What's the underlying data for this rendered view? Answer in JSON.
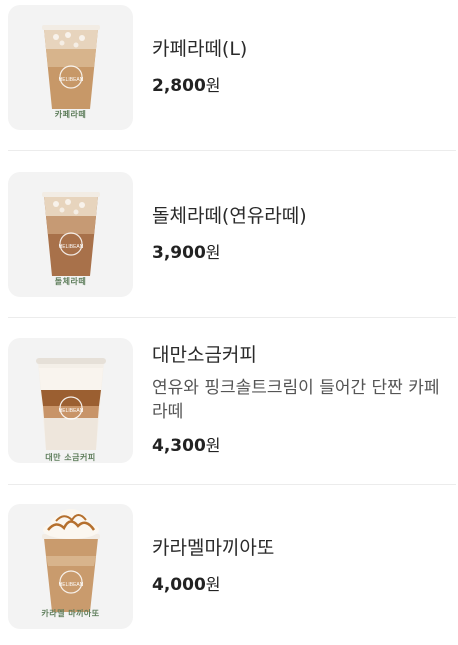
{
  "menu": {
    "items": [
      {
        "name": "카페라떼(L)",
        "price": "2,800",
        "currency": "원",
        "cup_label": "카페라떼",
        "cup_brand": "HELIBEAN",
        "image_icon": "iced-latte-cup-icon"
      },
      {
        "name": "돌체라떼(연유라떼)",
        "price": "3,900",
        "currency": "원",
        "cup_label": "돌체라떼",
        "cup_brand": "HELIBEAN",
        "image_icon": "iced-latte-cup-icon"
      },
      {
        "name": "대만소금커피",
        "description": "연유와 핑크솔트크림이 들어간 단짠 카페라떼",
        "price": "4,300",
        "currency": "원",
        "cup_label": "대만 소금커피",
        "cup_brand": "HELIBEAN",
        "image_icon": "layered-salt-coffee-cup-icon"
      },
      {
        "name": "카라멜마끼아또",
        "price": "4,000",
        "currency": "원",
        "cup_label": "카라멜 마끼아또",
        "cup_brand": "HELIBEAN",
        "image_icon": "whipped-caramel-cup-icon"
      }
    ]
  }
}
